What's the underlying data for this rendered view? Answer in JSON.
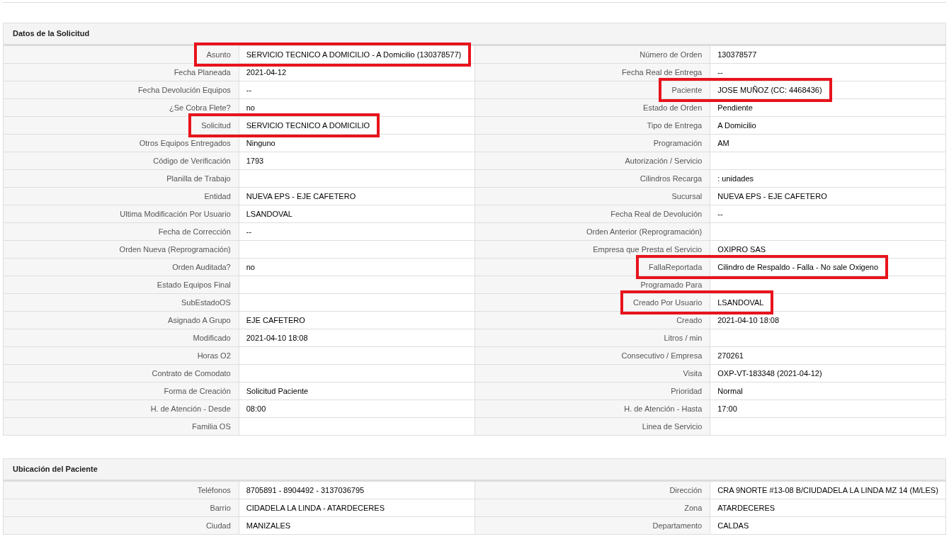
{
  "sections": [
    {
      "title": "Datos de la Solicitud",
      "rows": [
        [
          {
            "label": "Asunto",
            "value": "SERVICIO TECNICO A DOMICILIO - A Domicilio (130378577)",
            "highlighted": true
          },
          {
            "label": "Número de Orden",
            "value": "130378577",
            "highlighted": false
          }
        ],
        [
          {
            "label": "Fecha Planeada",
            "value": "2021-04-12",
            "highlighted": false
          },
          {
            "label": "Fecha Real de Entrega",
            "value": "--",
            "highlighted": false
          }
        ],
        [
          {
            "label": "Fecha Devolución Equipos",
            "value": "--",
            "highlighted": false
          },
          {
            "label": "Paciente",
            "value": "JOSE MUÑOZ (CC: 4468436)",
            "highlighted": true
          }
        ],
        [
          {
            "label": "¿Se Cobra Flete?",
            "value": "no",
            "highlighted": false
          },
          {
            "label": "Estado de Orden",
            "value": "Pendiente",
            "highlighted": false
          }
        ],
        [
          {
            "label": "Solicitud",
            "value": "SERVICIO TECNICO A DOMICILIO",
            "highlighted": true
          },
          {
            "label": "Tipo de Entrega",
            "value": "A Domicilio",
            "highlighted": false
          }
        ],
        [
          {
            "label": "Otros Equipos Entregados",
            "value": "Ninguno",
            "highlighted": false
          },
          {
            "label": "Programación",
            "value": "AM",
            "highlighted": false
          }
        ],
        [
          {
            "label": "Código de Verificación",
            "value": "1793",
            "highlighted": false
          },
          {
            "label": "Autorización / Servicio",
            "highlighted": false
          }
        ],
        [
          {
            "label": "Planilla de Trabajo",
            "highlighted": false
          },
          {
            "label": "Cilindros Recarga",
            "value": ": unidades",
            "highlighted": false
          }
        ],
        [
          {
            "label": "Entidad",
            "value": "NUEVA EPS - EJE CAFETERO",
            "highlighted": false
          },
          {
            "label": "Sucursal",
            "value": "NUEVA EPS - EJE CAFETERO",
            "highlighted": false
          }
        ],
        [
          {
            "label": "Ultima Modificación Por Usuario",
            "value": "LSANDOVAL",
            "highlighted": false
          },
          {
            "label": "Fecha Real de Devolución",
            "value": "--",
            "highlighted": false
          }
        ],
        [
          {
            "label": "Fecha de Corrección",
            "value": "--",
            "highlighted": false
          },
          {
            "label": "Orden Anterior (Reprogramación)",
            "highlighted": false
          }
        ],
        [
          {
            "label": "Orden Nueva (Reprogramación)",
            "highlighted": false
          },
          {
            "label": "Empresa que Presta el Servicio",
            "value": "OXIPRO SAS",
            "highlighted": false
          }
        ],
        [
          {
            "label": "Orden Auditada?",
            "value": "no",
            "highlighted": false
          },
          {
            "label": "FallaReportada",
            "value": "Cilindro de Respaldo - Falla - No sale Oxigeno",
            "highlighted": true
          }
        ],
        [
          {
            "label": "Estado Equipos Final",
            "highlighted": false
          },
          {
            "label": "Programado Para",
            "highlighted": false
          }
        ],
        [
          {
            "label": "SubEstadoOS",
            "highlighted": false
          },
          {
            "label": "Creado Por Usuario",
            "value": "LSANDOVAL",
            "highlighted": true
          }
        ],
        [
          {
            "label": "Asignado A Grupo",
            "value": "EJE CAFETERO",
            "highlighted": false
          },
          {
            "label": "Creado",
            "value": "2021-04-10 18:08",
            "highlighted": false
          }
        ],
        [
          {
            "label": "Modificado",
            "value": "2021-04-10 18:08",
            "highlighted": false
          },
          {
            "label": "Litros / min",
            "highlighted": false
          }
        ],
        [
          {
            "label": "Horas O2",
            "highlighted": false
          },
          {
            "label": "Consecutivo / Empresa",
            "value": "270261",
            "highlighted": false
          }
        ],
        [
          {
            "label": "Contrato de Comodato",
            "highlighted": false
          },
          {
            "label": "Visita",
            "value": "OXP-VT-183348 (2021-04-12)",
            "highlighted": false
          }
        ],
        [
          {
            "label": "Forma de Creación",
            "value": "Solicitud Paciente",
            "highlighted": false
          },
          {
            "label": "Prioridad",
            "value": "Normal",
            "highlighted": false
          }
        ],
        [
          {
            "label": "H. de Atención - Desde",
            "value": "08:00",
            "highlighted": false
          },
          {
            "label": "H. de Atención - Hasta",
            "value": "17:00",
            "highlighted": false
          }
        ],
        [
          {
            "label": "Familia OS",
            "highlighted": false
          },
          {
            "label": "Linea de Servicio",
            "highlighted": false
          }
        ]
      ]
    },
    {
      "title": "Ubicación del Paciente",
      "rows": [
        [
          {
            "label": "Teléfonos",
            "value": "8705891 - 8904492 - 3137036795",
            "highlighted": false
          },
          {
            "label": "Dirección",
            "value": "CRA 9NORTE #13-08 B/CIUDADELA LA LINDA MZ 14 (M/LES)",
            "highlighted": false
          }
        ],
        [
          {
            "label": "Barrio",
            "value": "CIDADELA LA LINDA - ATARDECERES",
            "highlighted": false
          },
          {
            "label": "Zona",
            "value": "ATARDECERES",
            "highlighted": false
          }
        ],
        [
          {
            "label": "Ciudad",
            "value": "MANIZALES",
            "highlighted": false
          },
          {
            "label": "Departamento",
            "value": "CALDAS",
            "highlighted": false
          }
        ]
      ]
    }
  ]
}
